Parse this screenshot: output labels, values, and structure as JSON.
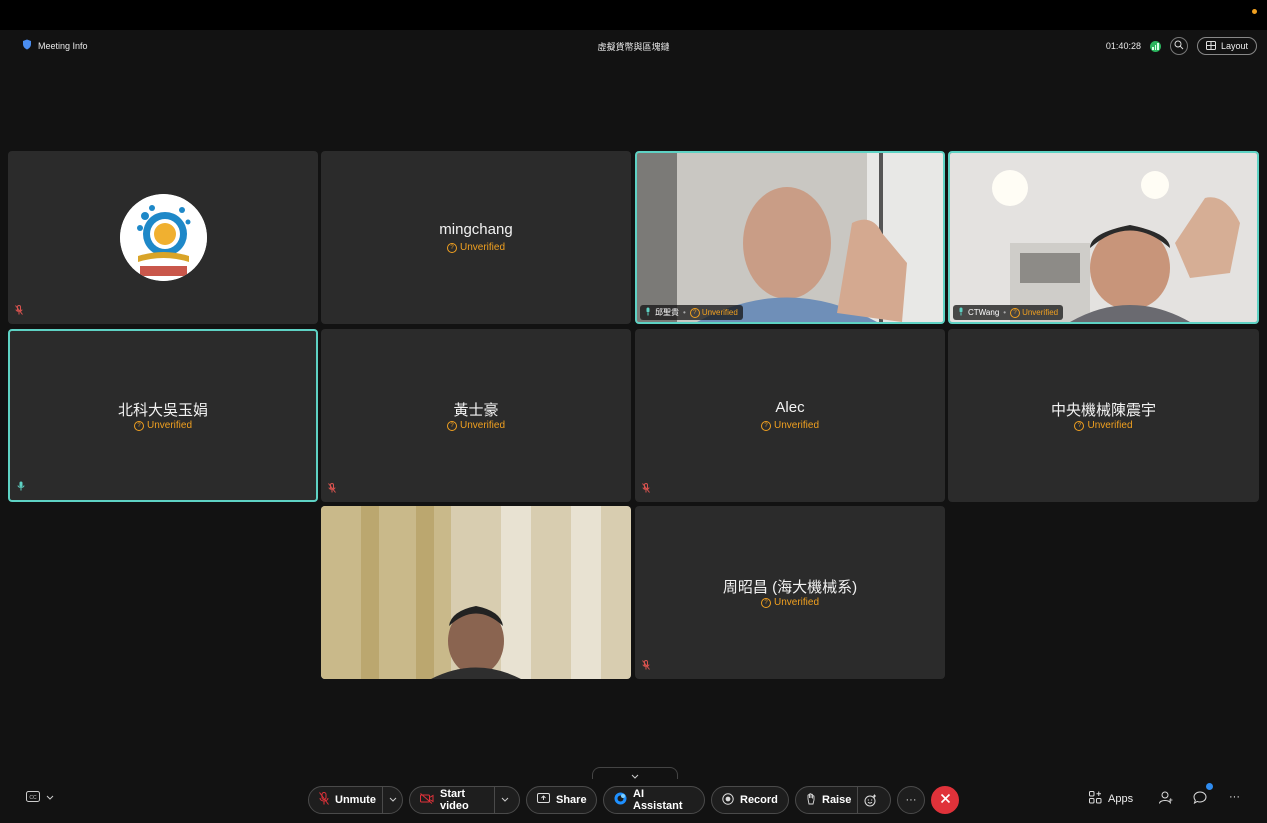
{
  "header": {
    "meeting_info_label": "Meeting Info",
    "meeting_title": "虛擬貨幣與區塊鏈",
    "timer": "01:40:28",
    "layout_label": "Layout"
  },
  "unverified_label": "Unverified",
  "tiles": [
    {
      "name": "",
      "muted": true,
      "type": "avatar"
    },
    {
      "name": "mingchang",
      "muted": false
    },
    {
      "name": "邱聖貴",
      "muted": false,
      "type": "video"
    },
    {
      "name": "CTWang",
      "muted": false,
      "type": "video"
    },
    {
      "name": "北科大吳玉娟",
      "muted": false,
      "active_speaker": true
    },
    {
      "name": "黃士豪",
      "muted": true
    },
    {
      "name": "Alec",
      "muted": true
    },
    {
      "name": "中央機械陳震宇",
      "muted": false
    },
    {
      "name": "",
      "muted": false,
      "type": "video"
    },
    {
      "name": "周昭昌 (海大機械系)",
      "muted": true
    }
  ],
  "toolbar": {
    "unmute_label": "Unmute",
    "start_video_label": "Start video",
    "share_label": "Share",
    "ai_assistant_label": "AI Assistant",
    "record_label": "Record",
    "raise_label": "Raise",
    "apps_label": "Apps"
  },
  "colors": {
    "accent_teal": "#5ed2c4",
    "warning_orange": "#f0a020",
    "end_call_red": "#e0323a",
    "muted_red": "#d9534f"
  }
}
